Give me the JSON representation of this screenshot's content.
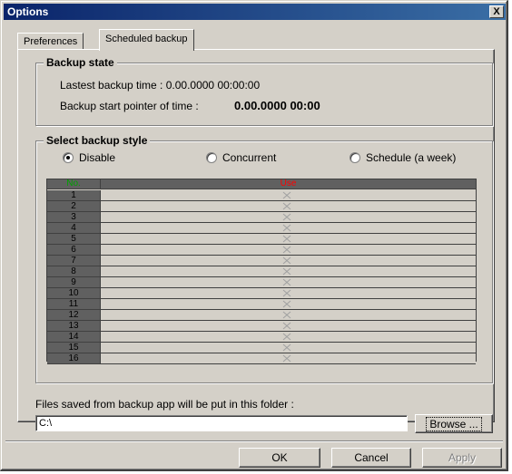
{
  "window": {
    "title": "Options",
    "close_label": "X"
  },
  "tabs": [
    {
      "label": "Preferences",
      "selected": false
    },
    {
      "label": "Scheduled backup",
      "selected": true
    }
  ],
  "backup_state": {
    "title": "Backup state",
    "last_backup_label": "Lastest backup time : 0.00.0000 00:00:00",
    "start_pointer_label": "Backup start pointer of time :",
    "start_pointer_value": "0.00.0000 00:00"
  },
  "backup_style": {
    "title": "Select backup style",
    "options": [
      {
        "label": "Disable",
        "selected": true
      },
      {
        "label": "Concurrent",
        "selected": false
      },
      {
        "label": "Schedule (a week)",
        "selected": false
      }
    ]
  },
  "grid": {
    "headers": {
      "no": "No.",
      "use": "Use"
    },
    "rows": [
      "1",
      "2",
      "3",
      "4",
      "5",
      "6",
      "7",
      "8",
      "9",
      "10",
      "11",
      "12",
      "13",
      "14",
      "15",
      "16"
    ],
    "use_mark_icon": "x-mark-icon"
  },
  "folder": {
    "label": "Files saved from backup app will be put in this folder :",
    "path_value": "C:\\",
    "browse_label": "Browse ..."
  },
  "buttons": {
    "ok": "OK",
    "cancel": "Cancel",
    "apply": "Apply"
  },
  "colors": {
    "title_bar": "#0a246a",
    "dialog_bg": "#d4d0c8",
    "grid_no_header": "#00a000",
    "grid_use_header": "#ff0000",
    "grid_dark": "#606060"
  }
}
